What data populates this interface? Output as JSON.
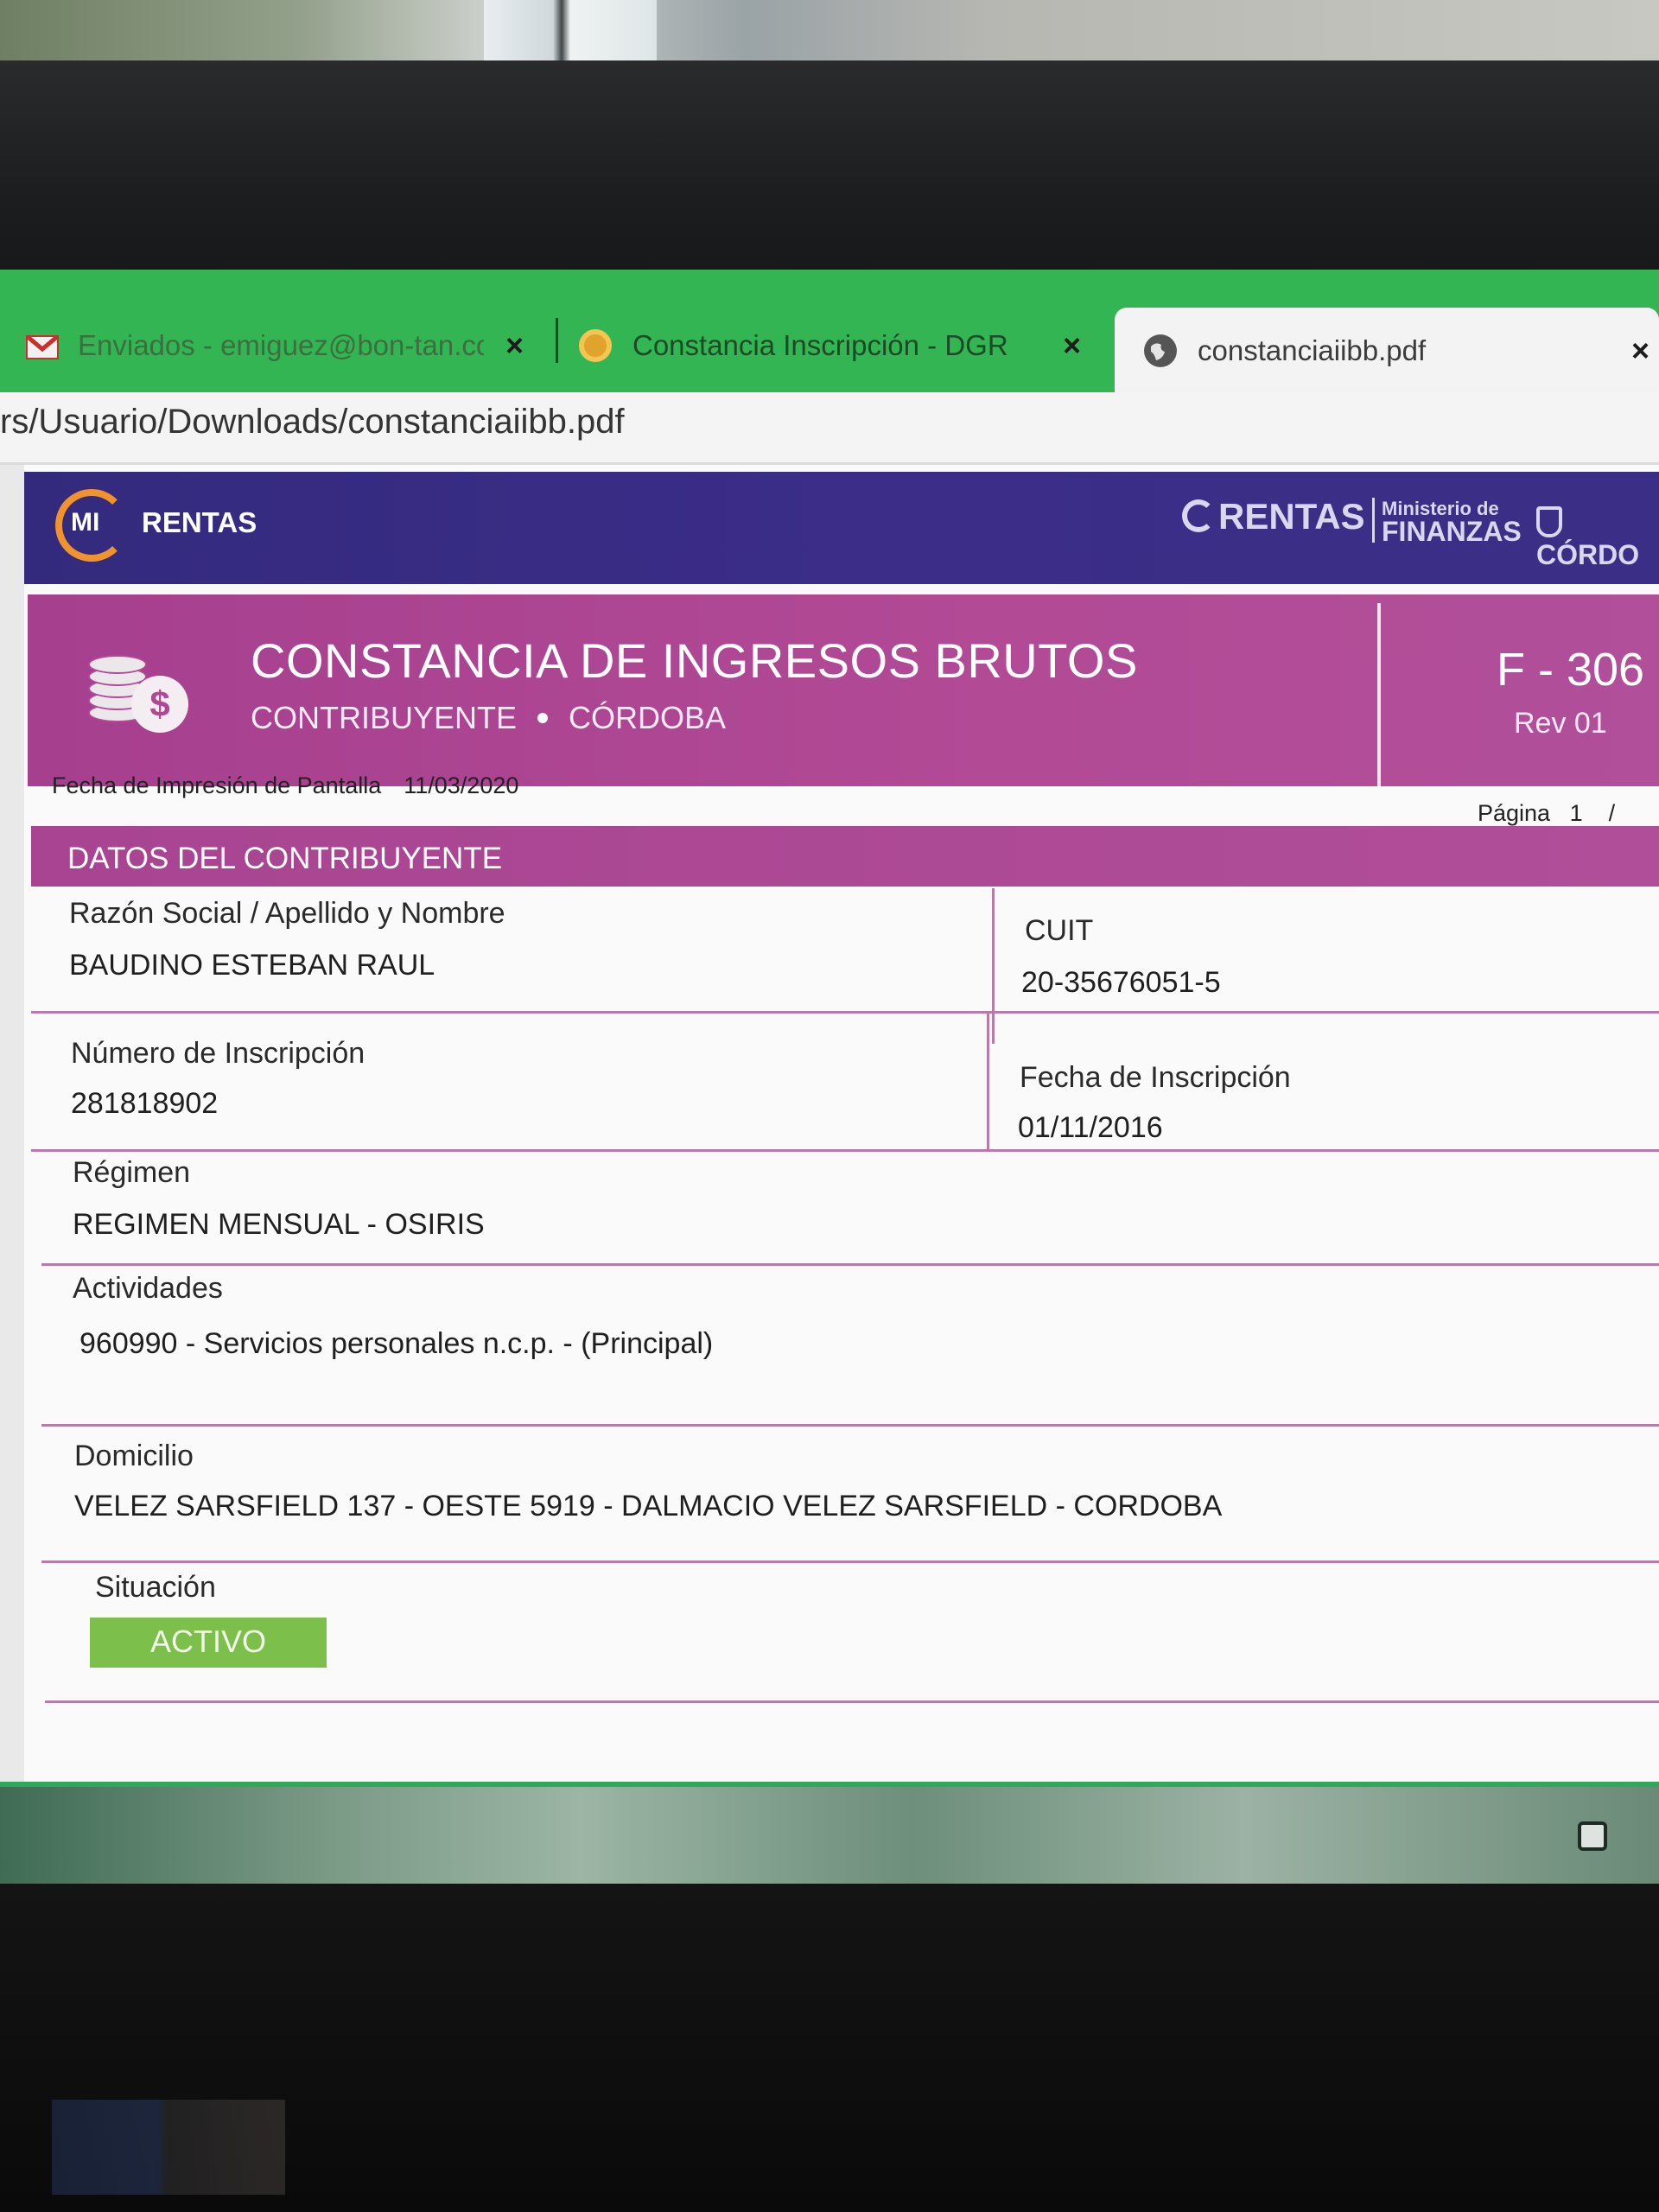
{
  "browser": {
    "tabs": [
      {
        "label": "Enviados - emiguez@bon-tan.co",
        "icon": "gmail-icon"
      },
      {
        "label": "Constancia Inscripción - DGR",
        "icon": "dgr-site-icon"
      },
      {
        "label": "constanciaiibb.pdf",
        "icon": "globe-icon",
        "active": true
      }
    ],
    "close_glyph": "×",
    "address": "rs/Usuario/Downloads/constanciaiibb.pdf"
  },
  "header": {
    "logo_mi": "MI",
    "logo_rentas": "RENTAS",
    "partner_rentas": "RENTAS",
    "partner_ministerio_small": "Ministerio de",
    "partner_ministerio_big": "FINANZAS",
    "partner_cordoba": "CÓRDO"
  },
  "document": {
    "title": "CONSTANCIA DE INGRESOS BRUTOS",
    "subtitle_left": "CONTRIBUYENTE",
    "subtitle_right": "CÓRDOBA",
    "form_code": "F - 306",
    "form_rev": "Rev 01",
    "print_label": "Fecha de Impresión de Pantalla",
    "print_date": "11/03/2020",
    "page_label": "Página",
    "page_number": "1",
    "page_sep": "/",
    "section_title": "DATOS DEL CONTRIBUYENTE",
    "fields": {
      "razon_social_label": "Razón Social / Apellido y Nombre",
      "razon_social_value": "BAUDINO ESTEBAN RAUL",
      "cuit_label": "CUIT",
      "cuit_value": "20-35676051-5",
      "numero_label": "Número de Inscripción",
      "numero_value": "281818902",
      "fecha_label": "Fecha de Inscripción",
      "fecha_value": "01/11/2016",
      "regimen_label": "Régimen",
      "regimen_value": "REGIMEN MENSUAL - OSIRIS",
      "actividades_label": "Actividades",
      "actividades_value": "960990 - Servicios personales n.c.p. - (Principal)",
      "domicilio_label": "Domicilio",
      "domicilio_value": "VELEZ SARSFIELD 137 - OESTE 5919 - DALMACIO VELEZ SARSFIELD - CORDOBA",
      "situacion_label": "Situación",
      "situacion_value": "ACTIVO"
    }
  },
  "colors": {
    "tab_strip": "#34b554",
    "header_band": "#3b2d88",
    "title_band": "#b24a96",
    "status_active": "#7cc04b"
  }
}
